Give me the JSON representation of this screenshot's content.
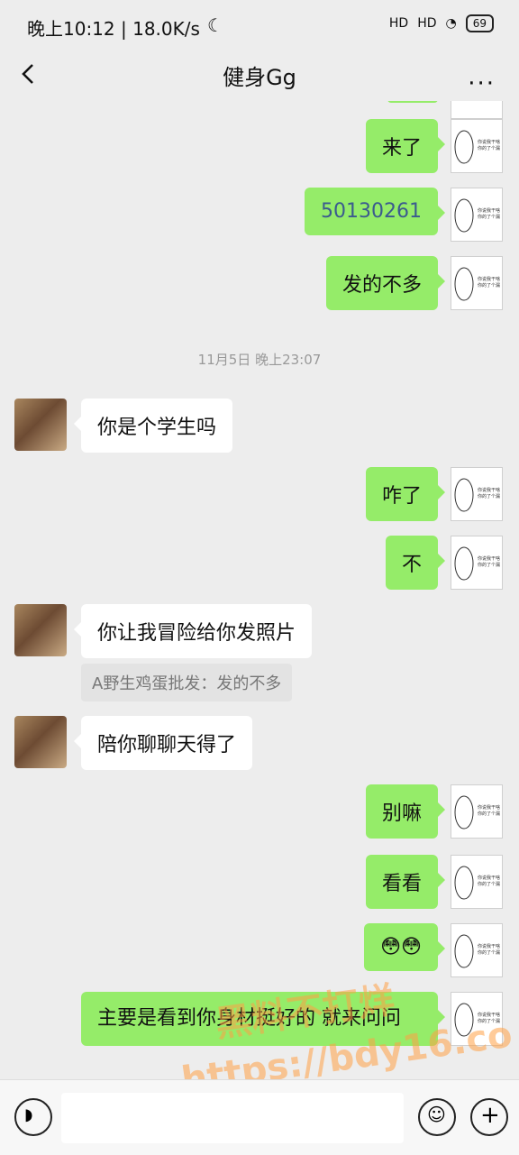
{
  "status_bar": {
    "left": "晚上10:12 | 18.0K/s",
    "signal_1": "HD",
    "signal_2": "HD",
    "battery": "69"
  },
  "header": {
    "title": "健身Gg",
    "more": "···"
  },
  "messages": {
    "m1": "来了",
    "m2": "50130261",
    "m3": "发的不多",
    "ts": "11月5日 晚上23:07",
    "m4": "你是个学生吗",
    "m5": "咋了",
    "m6": "不",
    "m7": "你让我冒险给你发照片",
    "m7_quote": "A野生鸡蛋批发：发的不多",
    "m8": "陪你聊聊天得了",
    "m9": "别嘛",
    "m10": "看看",
    "m11": "😳😳",
    "m12": "主要是看到你身材挺好的 就来问问"
  },
  "sticker_text": "你说我干啥 你的了个漏",
  "watermark": {
    "line1": "黑料不打烊",
    "line2": "https://bdy16.co"
  },
  "colors": {
    "bubble_green": "#95ec69",
    "background": "#ededed"
  }
}
